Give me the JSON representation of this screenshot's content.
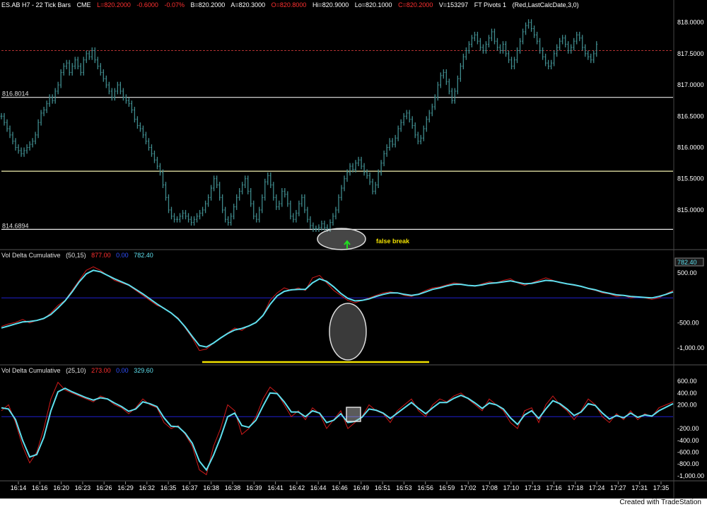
{
  "header": {
    "symbol": "ES.AB H7 - 22 Tick Bars",
    "exchange": "CME",
    "last": "L=820.2000",
    "change": "-0.6000",
    "pct": "-0.07%",
    "bid": "B=820.2000",
    "ask": "A=820.3000",
    "open": "O=820.8000",
    "high": "Hi=820.9000",
    "low": "Lo=820.1000",
    "close": "C=820.2000",
    "volume": "V=153297",
    "study": "FT Pivots 1",
    "study_params": "(Red,LastCalcDate,3,0)"
  },
  "colors": {
    "background": "#000000",
    "price_bars": "#3f8a8c",
    "pivot_white": "#e8e8e8",
    "pivot_yellow": "#f2f0b0",
    "pivot_red_dashed": "#b03030",
    "indicator_red": "#d11a1a",
    "indicator_cyan": "#5fe0ef",
    "zero_line": "#2020d0",
    "support_yellow": "#f0e000",
    "green_arrow": "#20e020"
  },
  "annotations": {
    "false_break": "false break",
    "pivot_high_label": "816.8014",
    "pivot_low_label": "814.6894"
  },
  "panel2": {
    "title": "Vol Delta Cumulative",
    "params": "(50,15)",
    "value_red": "877.00",
    "value_blue": "0.00",
    "value_cyan": "782.40",
    "last_box": "782.40"
  },
  "panel3": {
    "title": "Vol Delta Cumulative",
    "params": "(25,10)",
    "value_red": "273.00",
    "value_blue": "0.00",
    "value_cyan": "329.60"
  },
  "footer": {
    "credit": "Created with TradeStation"
  },
  "chart_data": [
    {
      "type": "bar",
      "title": "ES.AB H7 - 22 Tick Bars",
      "ylim": [
        814.4,
        818.2
      ],
      "y_ticks": [
        "818.0000",
        "817.5000",
        "817.0000",
        "816.5000",
        "816.0000",
        "815.5000",
        "815.0000"
      ],
      "pivot_lines": [
        816.8014,
        815.62,
        814.6894
      ],
      "pivot_line_labels": [
        "816.8014",
        "",
        "814.6894"
      ],
      "dashed_level": 817.55,
      "x": [
        0,
        4,
        8,
        12,
        16,
        20,
        24,
        28,
        32,
        36,
        40,
        44,
        48,
        52,
        56,
        60,
        64,
        68,
        72,
        76,
        80,
        84,
        88,
        92,
        96,
        100,
        104,
        108,
        112,
        116,
        120,
        124,
        128,
        132,
        136,
        140,
        144,
        148,
        152,
        156,
        160,
        164,
        168,
        172,
        176,
        180,
        184,
        188,
        192,
        196,
        200,
        204,
        208,
        212,
        216,
        220,
        224,
        228,
        232,
        236,
        240,
        244,
        248,
        252,
        256,
        260,
        264,
        268,
        272,
        276,
        280,
        284,
        288,
        292,
        296,
        300,
        304,
        308,
        312,
        316,
        320,
        324,
        328,
        332,
        336,
        340,
        344,
        348,
        352,
        356,
        360,
        364,
        368,
        372,
        376,
        380,
        384,
        388,
        392,
        396,
        400,
        404,
        408,
        412,
        416,
        420,
        424,
        428,
        432,
        436,
        440,
        444,
        448,
        452,
        456,
        460,
        464,
        468,
        472,
        476,
        480,
        484,
        488,
        492,
        496,
        500,
        504,
        508,
        512,
        516,
        520,
        524,
        528,
        532,
        536,
        540,
        544,
        548,
        552,
        556,
        560,
        564,
        568,
        572,
        576,
        580,
        584,
        588,
        592,
        596,
        600,
        604,
        608,
        612,
        616,
        620,
        624,
        628,
        632,
        636,
        640,
        644,
        648,
        652,
        656,
        660,
        664,
        668,
        672,
        676,
        680,
        684,
        688,
        692,
        696,
        700,
        704,
        708,
        712,
        716,
        720,
        724,
        728,
        732,
        736,
        740,
        744,
        748,
        752,
        756,
        760,
        764,
        768,
        772,
        776,
        780,
        784,
        788,
        792,
        796,
        800,
        804,
        808,
        812,
        816,
        820,
        824,
        828,
        832,
        836,
        840,
        844,
        848,
        852,
        856,
        860,
        864,
        868,
        872,
        876,
        880,
        884,
        888,
        892,
        896,
        900,
        904,
        908,
        912,
        916,
        920,
        924,
        928,
        932,
        936,
        940,
        944,
        948
      ],
      "values": [
        816.5,
        816.4,
        816.3,
        816.2,
        816.1,
        816.0,
        815.95,
        815.9,
        815.95,
        816.0,
        816.05,
        816.1,
        816.2,
        816.4,
        816.55,
        816.6,
        816.7,
        816.8,
        816.75,
        816.9,
        817.0,
        817.2,
        817.3,
        817.35,
        817.2,
        817.3,
        817.4,
        817.3,
        817.2,
        817.4,
        817.5,
        817.45,
        817.55,
        817.4,
        817.3,
        817.2,
        817.1,
        817.0,
        816.9,
        816.8,
        816.9,
        817.0,
        816.9,
        816.8,
        816.75,
        816.7,
        816.6,
        816.45,
        816.35,
        816.3,
        816.2,
        816.1,
        816.0,
        815.9,
        815.8,
        815.7,
        815.6,
        815.4,
        815.2,
        815.0,
        814.9,
        814.85,
        814.85,
        814.9,
        814.95,
        814.9,
        814.85,
        814.8,
        814.85,
        814.9,
        814.95,
        815.0,
        815.1,
        815.2,
        815.35,
        815.5,
        815.4,
        815.2,
        815.0,
        814.85,
        814.8,
        814.9,
        815.05,
        815.2,
        815.3,
        815.4,
        815.5,
        815.3,
        815.1,
        814.9,
        814.85,
        815.0,
        815.2,
        815.45,
        815.55,
        815.4,
        815.2,
        815.05,
        815.1,
        815.3,
        815.25,
        815.1,
        814.9,
        814.85,
        814.95,
        815.1,
        815.2,
        815.0,
        814.85,
        814.75,
        814.7,
        814.7,
        814.72,
        814.78,
        814.72,
        814.7,
        814.8,
        814.9,
        815.0,
        815.2,
        815.35,
        815.5,
        815.6,
        815.7,
        815.65,
        815.75,
        815.8,
        815.7,
        815.6,
        815.55,
        815.45,
        815.3,
        815.4,
        815.6,
        815.75,
        815.9,
        816.0,
        816.1,
        816.05,
        816.15,
        816.3,
        816.4,
        816.5,
        816.55,
        816.45,
        816.35,
        816.2,
        816.1,
        816.15,
        816.3,
        816.45,
        816.55,
        816.65,
        816.8,
        817.0,
        817.15,
        817.2,
        817.05,
        816.9,
        816.75,
        816.9,
        817.1,
        817.3,
        817.45,
        817.55,
        817.65,
        817.75,
        817.8,
        817.7,
        817.6,
        817.55,
        817.65,
        817.75,
        817.85,
        817.7,
        817.6,
        817.55,
        817.65,
        817.5,
        817.4,
        817.3,
        817.4,
        817.55,
        817.7,
        817.85,
        817.95,
        818.0,
        817.9,
        817.8,
        817.7,
        817.55,
        817.45,
        817.35,
        817.3,
        817.35,
        817.5,
        817.6,
        817.7,
        817.75,
        817.65,
        817.55,
        817.6,
        817.7,
        817.8,
        817.75,
        817.6,
        817.5,
        817.45,
        817.4,
        817.5,
        817.65
      ]
    },
    {
      "type": "line",
      "title": "Vol Delta Cumulative (50,15)",
      "ylim": [
        -1280,
        780
      ],
      "y_ticks": [
        "500.00",
        "-500.00",
        "-1,000.00"
      ],
      "x": [
        0,
        10,
        20,
        30,
        40,
        50,
        60,
        70,
        80,
        90,
        100,
        110,
        120,
        130,
        140,
        150,
        160,
        170,
        180,
        190,
        200,
        210,
        220,
        230,
        240,
        250,
        260,
        270,
        280,
        290,
        300,
        310,
        320,
        330,
        340,
        350,
        360,
        370,
        380,
        390,
        400,
        410,
        420,
        430,
        440,
        450,
        460,
        470,
        480,
        490,
        500,
        510,
        520,
        530,
        540,
        550,
        560,
        570,
        580,
        590,
        600,
        610,
        620,
        630,
        640,
        650,
        660,
        670,
        680,
        690,
        700,
        710,
        720,
        730,
        740,
        750,
        760,
        770,
        780,
        790,
        800,
        810,
        820,
        830,
        840,
        850,
        860,
        870,
        880,
        890,
        900,
        910,
        920,
        930,
        940,
        950
      ],
      "series": [
        {
          "values": [
            -570,
            -520,
            -490,
            -430,
            -500,
            -450,
            -420,
            -300,
            -150,
            -50,
            150,
            350,
            550,
            620,
            550,
            450,
            350,
            300,
            250,
            150,
            50,
            -50,
            -150,
            -200,
            -300,
            -400,
            -600,
            -800,
            -1050,
            -1020,
            -900,
            -800,
            -700,
            -600,
            -650,
            -550,
            -500,
            -350,
            -50,
            100,
            200,
            150,
            200,
            150,
            400,
            450,
            300,
            150,
            50,
            -50,
            -100,
            -50,
            0,
            50,
            100,
            120,
            100,
            50,
            30,
            80,
            150,
            200,
            220,
            260,
            300,
            280,
            250,
            230,
            280,
            320,
            300,
            350,
            380,
            300,
            250,
            300,
            350,
            400,
            350,
            300,
            280,
            250,
            230,
            180,
            150,
            100,
            80,
            30,
            50,
            0,
            20,
            0,
            -30,
            0,
            80,
            150
          ]
        },
        {
          "values": [
            -600,
            -560,
            -520,
            -480,
            -470,
            -450,
            -410,
            -330,
            -200,
            -60,
            120,
            320,
            480,
            550,
            520,
            450,
            380,
            320,
            260,
            170,
            80,
            -20,
            -120,
            -210,
            -300,
            -420,
            -580,
            -770,
            -950,
            -980,
            -900,
            -800,
            -710,
            -640,
            -610,
            -560,
            -490,
            -350,
            -130,
            40,
            130,
            160,
            170,
            170,
            300,
            380,
            330,
            220,
            90,
            -10,
            -60,
            -50,
            -20,
            30,
            70,
            100,
            100,
            70,
            50,
            70,
            120,
            170,
            200,
            240,
            270,
            270,
            250,
            240,
            260,
            290,
            300,
            320,
            340,
            310,
            280,
            290,
            320,
            350,
            340,
            310,
            280,
            260,
            230,
            190,
            160,
            120,
            90,
            60,
            50,
            30,
            20,
            10,
            0,
            30,
            70,
            120
          ]
        }
      ]
    },
    {
      "type": "line",
      "title": "Vol Delta Cumulative (25,10)",
      "ylim": [
        -1060,
        720
      ],
      "y_ticks": [
        "600.00",
        "400.00",
        "200.00",
        "-200.00",
        "-400.00",
        "-600.00",
        "-800.00",
        "-1,000.00"
      ],
      "x": [
        0,
        10,
        20,
        30,
        40,
        50,
        60,
        70,
        80,
        90,
        100,
        110,
        120,
        130,
        140,
        150,
        160,
        170,
        180,
        190,
        200,
        210,
        220,
        230,
        240,
        250,
        260,
        270,
        280,
        290,
        300,
        310,
        320,
        330,
        340,
        350,
        360,
        370,
        380,
        390,
        400,
        410,
        420,
        430,
        440,
        450,
        460,
        470,
        480,
        490,
        500,
        510,
        520,
        530,
        540,
        550,
        560,
        570,
        580,
        590,
        600,
        610,
        620,
        630,
        640,
        650,
        660,
        670,
        680,
        690,
        700,
        710,
        720,
        730,
        740,
        750,
        760,
        770,
        780,
        790,
        800,
        810,
        820,
        830,
        840,
        850,
        860,
        870,
        880,
        890,
        900,
        910,
        920,
        930,
        940,
        950
      ],
      "series": [
        {
          "values": [
            100,
            200,
            -100,
            -500,
            -780,
            -600,
            -200,
            300,
            580,
            450,
            400,
            350,
            300,
            250,
            350,
            300,
            200,
            150,
            50,
            150,
            300,
            200,
            150,
            -100,
            -200,
            -150,
            -300,
            -500,
            -900,
            -980,
            -500,
            -200,
            200,
            100,
            -300,
            -200,
            0,
            300,
            500,
            400,
            200,
            0,
            100,
            -50,
            150,
            50,
            -200,
            -50,
            100,
            -200,
            -100,
            0,
            200,
            100,
            50,
            -100,
            100,
            200,
            300,
            100,
            0,
            200,
            300,
            250,
            350,
            400,
            300,
            200,
            100,
            300,
            200,
            100,
            -100,
            -200,
            100,
            150,
            -100,
            200,
            350,
            200,
            100,
            -50,
            100,
            300,
            200,
            0,
            -100,
            50,
            -50,
            100,
            -50,
            50,
            0,
            150,
            200,
            250
          ]
        },
        {
          "values": [
            150,
            130,
            -50,
            -400,
            -680,
            -640,
            -350,
            100,
            420,
            480,
            420,
            370,
            320,
            280,
            320,
            300,
            230,
            170,
            90,
            130,
            250,
            220,
            170,
            -20,
            -160,
            -170,
            -280,
            -450,
            -750,
            -900,
            -650,
            -350,
            0,
            60,
            -150,
            -180,
            -60,
            180,
            400,
            390,
            250,
            80,
            80,
            0,
            100,
            60,
            -100,
            -60,
            50,
            -100,
            -80,
            -10,
            130,
            110,
            60,
            -30,
            60,
            150,
            240,
            140,
            50,
            150,
            240,
            240,
            310,
            360,
            310,
            230,
            140,
            230,
            200,
            130,
            -20,
            -130,
            30,
            100,
            -30,
            130,
            270,
            220,
            130,
            20,
            80,
            220,
            190,
            60,
            -40,
            20,
            -20,
            60,
            -10,
            30,
            10,
            100,
            160,
            220
          ]
        }
      ]
    }
  ],
  "x_axis_labels": [
    "16:14",
    "16:16",
    "16:20",
    "16:23",
    "16:26",
    "16:29",
    "16:32",
    "16:35",
    "16:37",
    "16:38",
    "16:38",
    "16:39",
    "16:41",
    "16:42",
    "16:44",
    "16:46",
    "16:49",
    "16:51",
    "16:53",
    "16:56",
    "16:59",
    "17:02",
    "17:08",
    "17:10",
    "17:13",
    "17:16",
    "17:18",
    "17:24",
    "17:27",
    "17:31",
    "17:35"
  ]
}
